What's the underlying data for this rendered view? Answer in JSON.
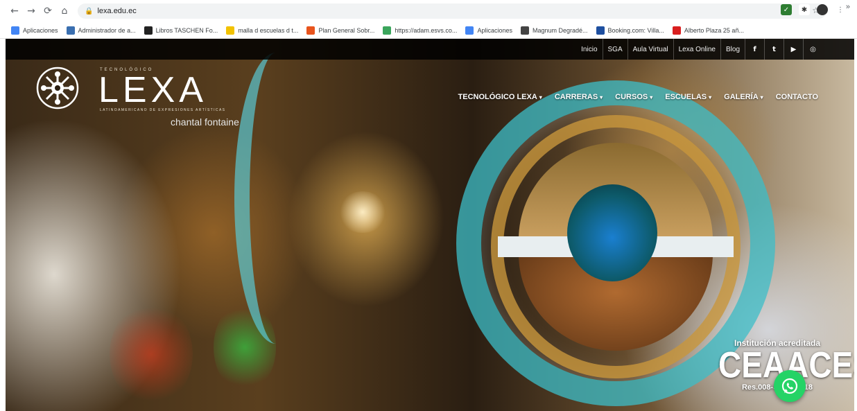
{
  "browser": {
    "url": "lexa.edu.ec",
    "bookmarks": [
      {
        "label": "Aplicaciones",
        "color": "#4285f4"
      },
      {
        "label": "Administrador de a...",
        "color": "#3a6fb0"
      },
      {
        "label": "Libros TASCHEN Fo...",
        "color": "#222222"
      },
      {
        "label": "malla d escuelas d t...",
        "color": "#f2c200"
      },
      {
        "label": "Plan General Sobr...",
        "color": "#e8541d"
      },
      {
        "label": "https://adam.esvs.co...",
        "color": "#3ba55c"
      },
      {
        "label": "Aplicaciones",
        "color": "#4285f4"
      },
      {
        "label": "Magnum Degradé...",
        "color": "#444444"
      },
      {
        "label": "Booking.com: Villa...",
        "color": "#1e4fa0"
      },
      {
        "label": "Alberto Plaza 25 añ...",
        "color": "#d91f1f"
      }
    ]
  },
  "site": {
    "topbar": {
      "links": [
        "Inicio",
        "SGA",
        "Aula Virtual",
        "Lexa Online",
        "Blog"
      ],
      "social": [
        "f",
        "t",
        "▶",
        "◎"
      ]
    },
    "logo": {
      "word": "LEXA",
      "top_text": "TECNOLÓGICO",
      "tagline": "LATINOAMERICANO DE EXPRESIONES ARTÍSTICAS",
      "sub": "chantal fontaine"
    },
    "nav": [
      {
        "label": "TECNOLÓGICO LEXA",
        "dropdown": true
      },
      {
        "label": "CARRERAS",
        "dropdown": true
      },
      {
        "label": "CURSOS",
        "dropdown": true
      },
      {
        "label": "ESCUELAS",
        "dropdown": true
      },
      {
        "label": "GALERÍA",
        "dropdown": true
      },
      {
        "label": "CONTACTO",
        "dropdown": false
      }
    ],
    "badge": {
      "line1": "Institución acreditada",
      "big": "CEAACES",
      "res": "Res.008-SO-...-2018"
    }
  }
}
